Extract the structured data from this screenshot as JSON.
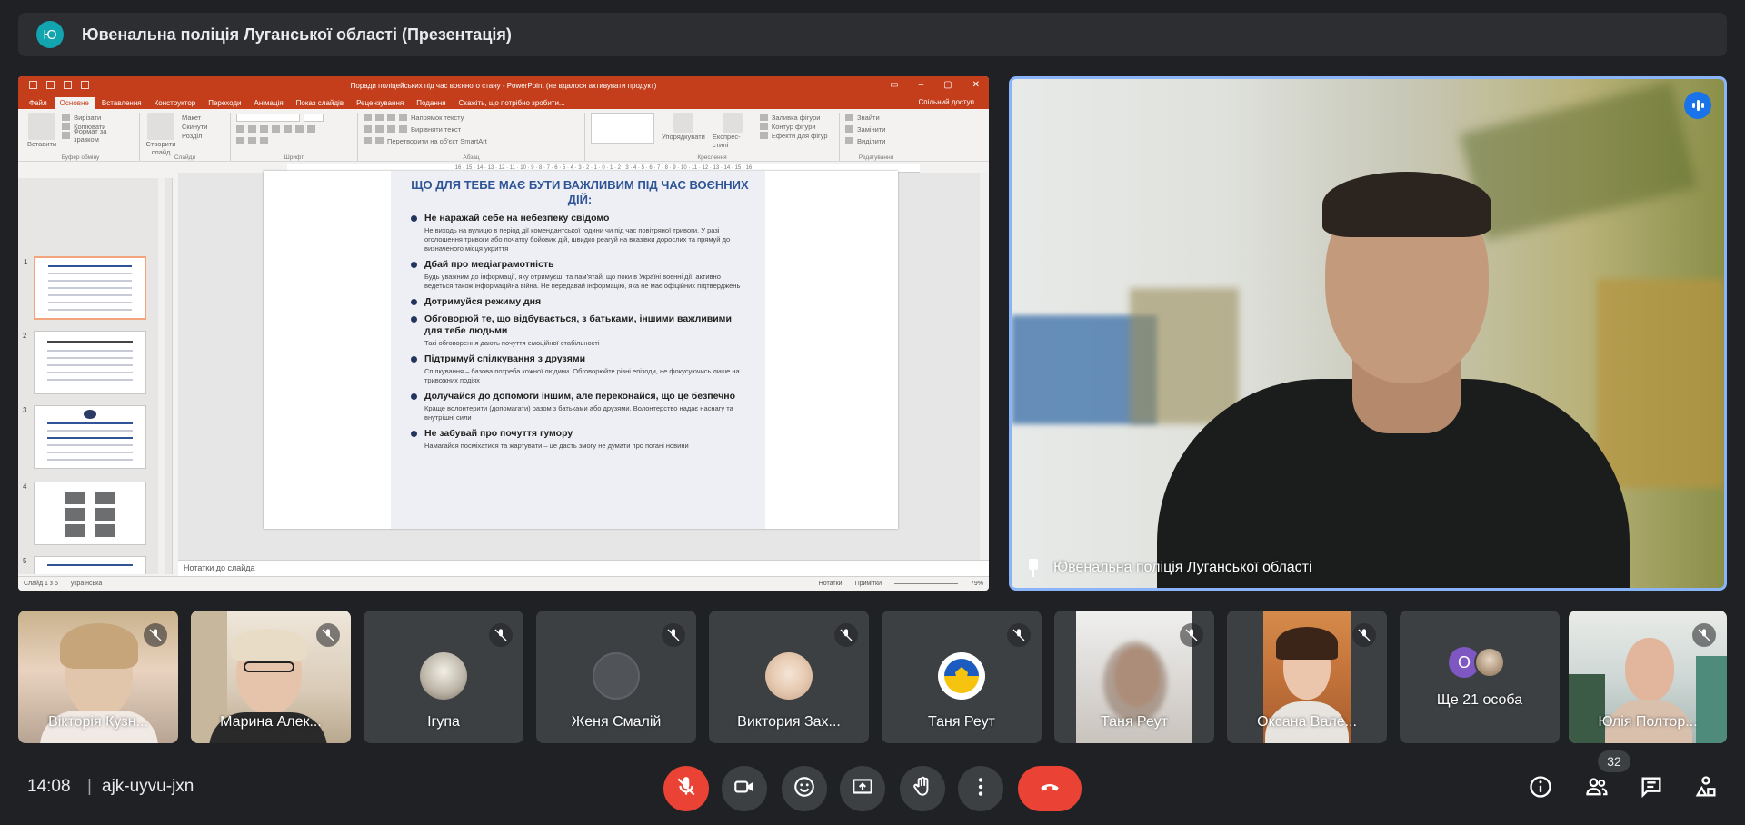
{
  "meeting": {
    "avatar_letter": "Ю",
    "title": "Ювенальна поліція Луганської області (Презентація)",
    "time": "14:08",
    "separator": "|",
    "code": "ajk-uyvu-jxn",
    "participant_count": "32"
  },
  "powerpoint": {
    "window_title": "Поради поліцейських під час воєнного стану - PowerPoint (не вдалося активувати продукт)",
    "tabs": [
      "Файл",
      "Основне",
      "Вставлення",
      "Конструктор",
      "Переходи",
      "Анімація",
      "Показ слайдів",
      "Рецензування",
      "Подання",
      "Скажіть, що потрібно зробити..."
    ],
    "share": "Спільний доступ",
    "ribbon_groups": [
      "Буфер обміну",
      "Слайди",
      "Шрифт",
      "Абзац",
      "Креслення",
      "Редагування"
    ],
    "ribbon_labels": {
      "paste": "Вставити",
      "cut": "Вирізати",
      "copy": "Копіювати",
      "format_painter": "Формат за зразком",
      "new_slide": "Створити слайд",
      "layout": "Макет",
      "reset": "Скинути",
      "section": "Розділ",
      "text_direction": "Напрямок тексту",
      "align_text": "Вирівняти текст",
      "smartart": "Перетворити на об'єкт SmartArt",
      "arrange": "Упорядкувати",
      "quick_styles": "Експрес-стилі",
      "shape_fill": "Заливка фігури",
      "shape_outline": "Контур фігури",
      "shape_effects": "Ефекти для фігур",
      "find": "Знайти",
      "replace": "Замінити",
      "select": "Виділити"
    },
    "ruler": "16 · 15 · 14 · 13 · 12 · 11 · 10 · 9 · 8 · 7 · 6 · 5 · 4 · 3 · 2 · 1 · 0 · 1 · 2 · 3 · 4 · 5 · 6 · 7 · 8 · 9 · 10 · 11 · 12 · 13 · 14 · 15 · 16",
    "thumb_numbers": [
      "1",
      "2",
      "3",
      "4",
      "5"
    ],
    "notes_placeholder": "Нотатки до слайда",
    "status": {
      "slide": "Слайд 1 з 5",
      "language": "українська",
      "notes": "Нотатки",
      "comments": "Примітки",
      "zoom": "79%"
    },
    "slide": {
      "heading": "ЩО ДЛЯ ТЕБЕ МАЄ БУТИ ВАЖЛИВИМ ПІД ЧАС ВОЄННИХ ДІЙ:",
      "items": [
        {
          "title": "Не наражай себе на небезпеку свідомо",
          "text": "Не виходь на вулицю в період дії комендантської години чи під час повітряної тривоги. У разі оголошення тривоги або початку бойових дій, швидко реагуй на вказівки дорослих та прямуй до визначеного місця укриття"
        },
        {
          "title": "Дбай про медіаграмотність",
          "text": "Будь уважним до інформації, яку отримуєш, та пам'ятай, що поки в Україні воєнні дії, активно ведеться також інформаційна війна. Не передавай інформацію, яка не має офіційних підтверджень"
        },
        {
          "title": "Дотримуйся режиму дня",
          "text": ""
        },
        {
          "title": "Обговорюй те, що відбувається, з батьками, іншими важливими для тебе людьми",
          "text": "Такі обговорення дають почуття емоційної стабільності"
        },
        {
          "title": "Підтримуй спілкування з друзями",
          "text": "Спілкування – базова потреба кожної людини. Обговорюйте різні епізоди, не фокусуючись лише на тривожних подіях"
        },
        {
          "title": "Долучайся до допомоги іншим, але переконайся, що це безпечно",
          "text": "Краще волонтерити (допомагати) разом з батьками або друзями. Волонтерство надає наснагу та внутрішні сили"
        },
        {
          "title": "Не забувай про почуття гумору",
          "text": "Намагайся посміхатися та жартувати – це дасть змогу не думати про погані новини"
        }
      ]
    }
  },
  "speaker": {
    "name": "Ювенальна поліція Луганської області"
  },
  "participants": [
    {
      "name": "Вікторія Кузн...",
      "kind": "video"
    },
    {
      "name": "Марина Алек...",
      "kind": "video"
    },
    {
      "name": "Ігупа",
      "kind": "avatar"
    },
    {
      "name": "Женя Смалій",
      "kind": "avatar"
    },
    {
      "name": "Виктория Зах...",
      "kind": "avatar"
    },
    {
      "name": "Таня Реут",
      "kind": "avatar"
    },
    {
      "name": "Таня Реут",
      "kind": "video"
    },
    {
      "name": "Оксана Вале...",
      "kind": "video"
    },
    {
      "name": "Ще 21 особа",
      "kind": "more",
      "more_letter": "O"
    },
    {
      "name": "Юлія Полтор...",
      "kind": "video"
    }
  ],
  "colors": {
    "accent_blue": "#8ab4f8",
    "ppt_red": "#c43e1c",
    "hangup_red": "#ea4335",
    "meet_bg": "#202124"
  },
  "icons": [
    "mic-off-icon",
    "camera-icon",
    "emoji-icon",
    "present-icon",
    "raise-hand-icon",
    "more-icon",
    "hangup-icon",
    "info-icon",
    "people-icon",
    "chat-icon",
    "activities-icon",
    "pin-icon",
    "audio-level-icon"
  ]
}
